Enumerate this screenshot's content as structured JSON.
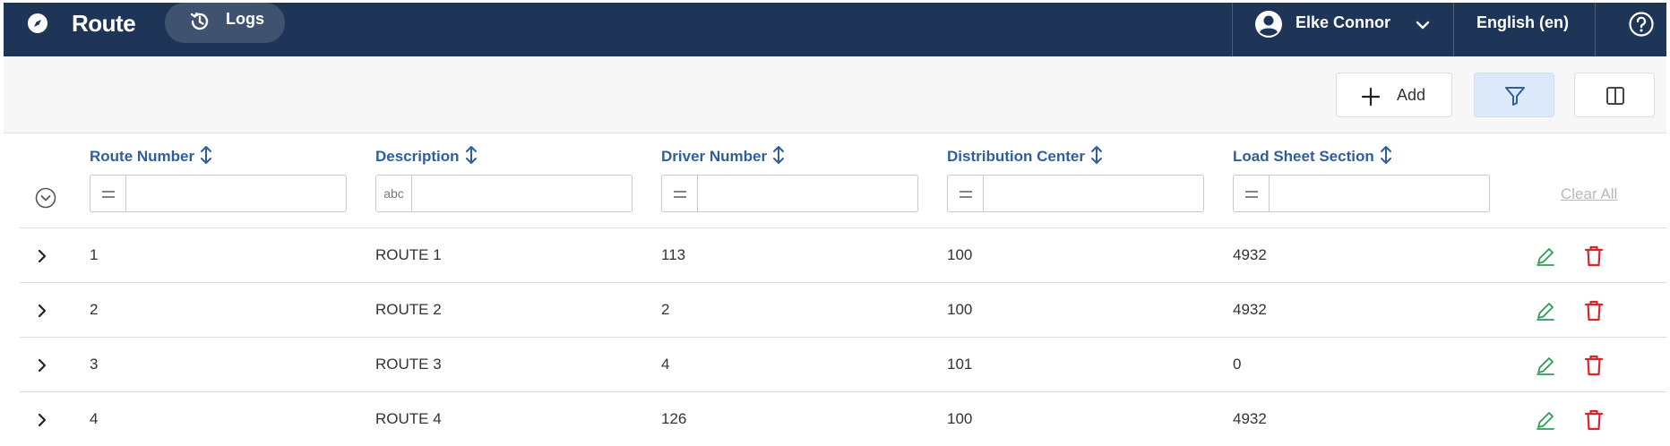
{
  "header": {
    "title": "Route",
    "logs_label": "Logs",
    "user_name": "Elke Connor",
    "language": "English (en)"
  },
  "toolbar": {
    "add_label": "Add"
  },
  "table": {
    "columns": [
      {
        "label": "Route Number",
        "filter_op": "="
      },
      {
        "label": "Description",
        "filter_op": "abc"
      },
      {
        "label": "Driver Number",
        "filter_op": "="
      },
      {
        "label": "Distribution Center",
        "filter_op": "="
      },
      {
        "label": "Load Sheet Section",
        "filter_op": "="
      }
    ],
    "clear_all_label": "Clear All",
    "rows": [
      {
        "route_number": "1",
        "description": "ROUTE 1",
        "driver_number": "113",
        "distribution_center": "100",
        "load_sheet_section": "4932"
      },
      {
        "route_number": "2",
        "description": "ROUTE 2",
        "driver_number": "2",
        "distribution_center": "100",
        "load_sheet_section": "4932"
      },
      {
        "route_number": "3",
        "description": "ROUTE 3",
        "driver_number": "4",
        "distribution_center": "101",
        "load_sheet_section": "0"
      },
      {
        "route_number": "4",
        "description": "ROUTE 4",
        "driver_number": "126",
        "distribution_center": "100",
        "load_sheet_section": "4932"
      }
    ]
  },
  "icons": {
    "compass": "compass-icon",
    "logs": "history-icon",
    "user": "user-avatar-icon",
    "chevron": "chevron-down-icon",
    "help": "help-icon",
    "add": "plus-icon",
    "filter": "filter-icon",
    "columns": "columns-icon",
    "sort": "sort-icon",
    "collapse": "collapse-all-icon",
    "expand": "chevron-right-icon",
    "edit": "pencil-icon",
    "delete": "trash-icon"
  },
  "colors": {
    "nav_bg": "#1f3557",
    "link_blue": "#2f5e9e",
    "edit_green": "#2e9c57",
    "delete_red": "#d9252b",
    "filter_active_bg": "#dbe9fb"
  }
}
